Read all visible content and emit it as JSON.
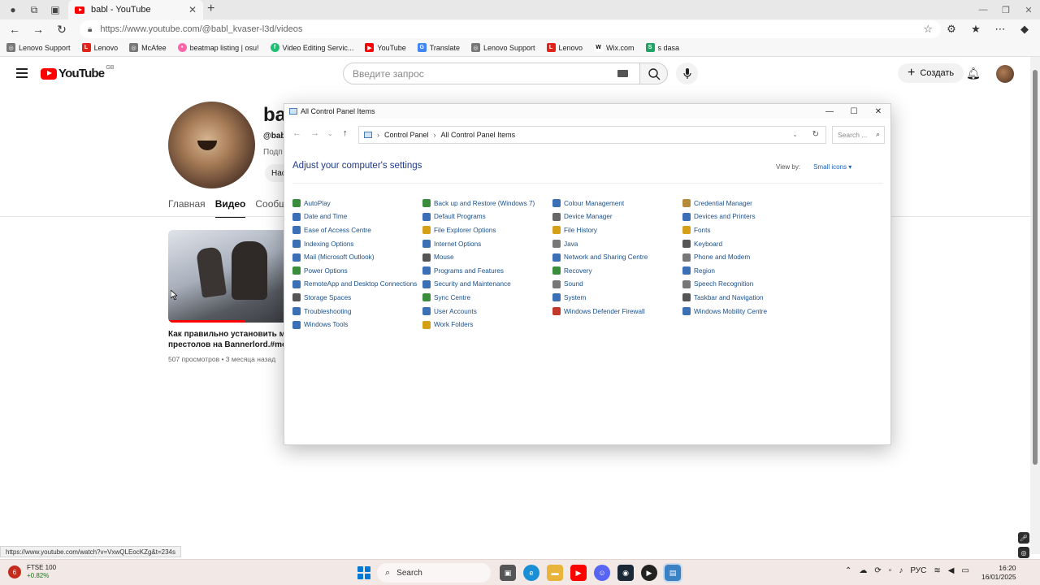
{
  "browser": {
    "tab_title": "babl - YouTube",
    "url": "https://www.youtube.com/@babl_kvaser-l3d/videos",
    "bookmarks": [
      "Lenovo Support",
      "Lenovo",
      "McAfee",
      "beatmap listing | osu!",
      "Video Editing Servic...",
      "YouTube",
      "Translate",
      "Lenovo Support",
      "Lenovo",
      "Wix.com",
      "s dasa"
    ],
    "status_url": "https://www.youtube.com/watch?v=VxwQLEocKZg&t=234s"
  },
  "youtube": {
    "logo_text": "YouTube",
    "region": "GB",
    "search_placeholder": "Введите запрос",
    "create_label": "Создать",
    "channel_name": "ba",
    "channel_handle": "@bab",
    "channel_sub": "Подп",
    "channel_btn": "Нас",
    "tabs": [
      "Главная",
      "Видео",
      "Сообще"
    ],
    "video": {
      "title_line1": "Как правильно установить моды",
      "title_line2": "престолов на Bannerlord.#mount",
      "meta": "507 просмотров • 3 месяца назад",
      "watch_progress": 0.66
    }
  },
  "control_panel": {
    "window_title": "All Control Panel Items",
    "breadcrumb": [
      "Control Panel",
      "All Control Panel Items"
    ],
    "search_placeholder": "Search ...",
    "heading": "Adjust your computer's settings",
    "view_by_label": "View by:",
    "view_by_value": "Small icons",
    "items": [
      {
        "label": "AutoPlay",
        "color": "#3a8d3a"
      },
      {
        "label": "Back up and Restore (Windows 7)",
        "color": "#3a8d3a"
      },
      {
        "label": "Colour Management",
        "color": "#3b6fb6"
      },
      {
        "label": "Credential Manager",
        "color": "#b58a3a"
      },
      {
        "label": "Date and Time",
        "color": "#3b6fb6"
      },
      {
        "label": "Default Programs",
        "color": "#3b6fb6"
      },
      {
        "label": "Device Manager",
        "color": "#666666"
      },
      {
        "label": "Devices and Printers",
        "color": "#3b6fb6"
      },
      {
        "label": "Ease of Access Centre",
        "color": "#3b6fb6"
      },
      {
        "label": "File Explorer Options",
        "color": "#d4a017"
      },
      {
        "label": "File History",
        "color": "#d4a017"
      },
      {
        "label": "Fonts",
        "color": "#d4a017"
      },
      {
        "label": "Indexing Options",
        "color": "#3b6fb6"
      },
      {
        "label": "Internet Options",
        "color": "#3b6fb6"
      },
      {
        "label": "Java",
        "color": "#777777"
      },
      {
        "label": "Keyboard",
        "color": "#555555"
      },
      {
        "label": "Mail (Microsoft Outlook)",
        "color": "#3b6fb6"
      },
      {
        "label": "Mouse",
        "color": "#555555"
      },
      {
        "label": "Network and Sharing Centre",
        "color": "#3b6fb6"
      },
      {
        "label": "Phone and Modem",
        "color": "#777777"
      },
      {
        "label": "Power Options",
        "color": "#3a8d3a"
      },
      {
        "label": "Programs and Features",
        "color": "#3b6fb6"
      },
      {
        "label": "Recovery",
        "color": "#3a8d3a"
      },
      {
        "label": "Region",
        "color": "#3b6fb6"
      },
      {
        "label": "RemoteApp and Desktop Connections",
        "color": "#3b6fb6"
      },
      {
        "label": "Security and Maintenance",
        "color": "#3b6fb6"
      },
      {
        "label": "Sound",
        "color": "#777777"
      },
      {
        "label": "Speech Recognition",
        "color": "#777777"
      },
      {
        "label": "Storage Spaces",
        "color": "#555555"
      },
      {
        "label": "Sync Centre",
        "color": "#3a8d3a"
      },
      {
        "label": "System",
        "color": "#3b6fb6"
      },
      {
        "label": "Taskbar and Navigation",
        "color": "#555555"
      },
      {
        "label": "Troubleshooting",
        "color": "#3b6fb6"
      },
      {
        "label": "User Accounts",
        "color": "#3b6fb6"
      },
      {
        "label": "Windows Defender Firewall",
        "color": "#c0392b"
      },
      {
        "label": "Windows Mobility Centre",
        "color": "#3b6fb6"
      },
      {
        "label": "Windows Tools",
        "color": "#3b6fb6"
      },
      {
        "label": "Work Folders",
        "color": "#d4a017"
      }
    ]
  },
  "taskbar": {
    "ftse_badge": "6",
    "ftse_name": "FTSE 100",
    "ftse_change": "+0.82%",
    "search_label": "Search",
    "lang": "РУС",
    "time": "16:20",
    "date": "16/01/2025"
  }
}
